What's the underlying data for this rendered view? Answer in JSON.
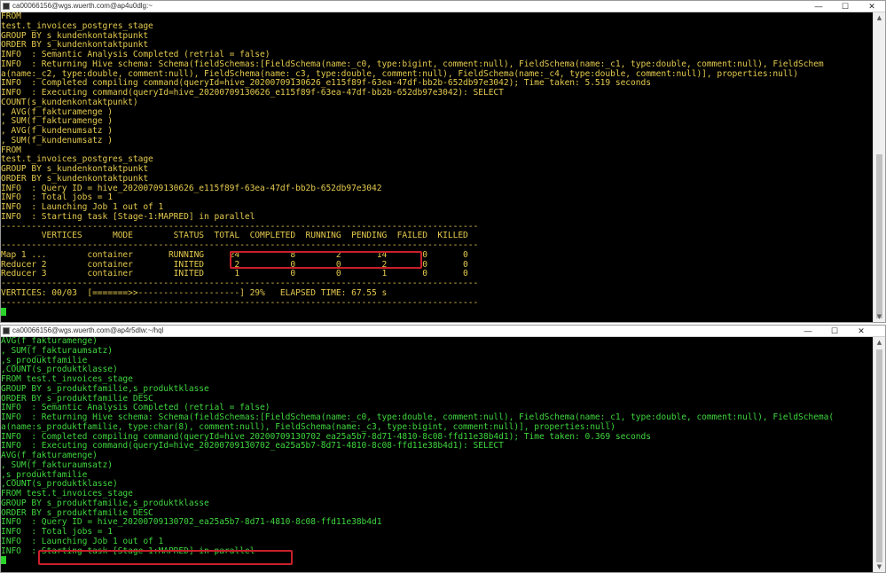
{
  "window_top": {
    "title": "ca00066156@wgs.wuerth.com@ap4u0dlg:~",
    "controls": [
      "—",
      "☐",
      "✕"
    ],
    "lines": [
      "FROM",
      "test.t_invoices_postgres_stage",
      "GROUP BY s_kundenkontaktpunkt",
      "ORDER BY s_kundenkontaktpunkt",
      "INFO  : Semantic Analysis Completed (retrial = false)",
      "INFO  : Returning Hive schema: Schema(fieldSchemas:[FieldSchema(name:_c0, type:bigint, comment:null), FieldSchema(name:_c1, type:double, comment:null), FieldSchem",
      "a(name:_c2, type:double, comment:null), FieldSchema(name:_c3, type:double, comment:null), FieldSchema(name:_c4, type:double, comment:null)], properties:null)",
      "INFO  : Completed compiling command(queryId=hive_20200709130626_e115f89f-63ea-47df-bb2b-652db97e3042); Time taken: 5.519 seconds",
      "INFO  : Executing command(queryId=hive_20200709130626_e115f89f-63ea-47df-bb2b-652db97e3042): SELECT",
      "COUNT(s_kundenkontaktpunkt)",
      ", AVG(f_fakturamenge )",
      ", SUM(f_fakturamenge )",
      ", AVG(f_kundenumsatz )",
      ", SUM(f_kundenumsatz )",
      "FROM",
      "test.t_invoices_postgres_stage",
      "GROUP BY s_kundenkontaktpunkt",
      "ORDER BY s_kundenkontaktpunkt",
      "INFO  : Query ID = hive_20200709130626_e115f89f-63ea-47df-bb2b-652db97e3042",
      "INFO  : Total jobs = 1",
      "INFO  : Launching Job 1 out of 1",
      "INFO  : Starting task [Stage-1:MAPRED] in parallel"
    ],
    "separator": "----------------------------------------------------------------------------------------------",
    "table_header": "        VERTICES      MODE        STATUS  TOTAL  COMPLETED  RUNNING  PENDING  FAILED  KILLED",
    "table_rows": [
      "Map 1 ...        container       RUNNING     24          8        2       14       0       0",
      "Reducer 2        container        INITED      2          0        0        2       0       0",
      "Reducer 3        container        INITED      1          0        0        1       0       0"
    ],
    "progress_line": "VERTICES: 00/03  [=======>>--------------------] 29%   ELAPSED TIME: 67.55 s",
    "highlight_color": "#c8202a"
  },
  "window_bottom": {
    "title": "ca00066156@wgs.wuerth.com@ap4r5dlw:~/hql",
    "controls": [
      "—",
      "☐",
      "✕"
    ],
    "lines": [
      "AVG(f_fakturamenge)",
      ", SUM(f_fakturaumsatz)",
      ",s_produktfamilie",
      ",COUNT(s_produktklasse)",
      "FROM test.t_invoices_stage",
      "GROUP BY s_produktfamilie,s_produktklasse",
      "ORDER BY s_produktfamilie DESC",
      "INFO  : Semantic Analysis Completed (retrial = false)",
      "INFO  : Returning Hive schema: Schema(fieldSchemas:[FieldSchema(name:_c0, type:double, comment:null), FieldSchema(name:_c1, type:double, comment:null), FieldSchema(",
      "a(name:s_produktfamilie, type:char(8), comment:null), FieldSchema(name:_c3, type:bigint, comment:null)], properties:null)",
      "INFO  : Completed compiling command(queryId=hive_20200709130702_ea25a5b7-8d71-4810-8c08-ffd11e38b4d1); Time taken: 0.369 seconds",
      "INFO  : Executing command(queryId=hive_20200709130702_ea25a5b7-8d71-4810-8c08-ffd11e38b4d1): SELECT",
      "AVG(f_fakturamenge)",
      ", SUM(f_fakturaumsatz)",
      ",s_produktfamilie",
      ",COUNT(s_produktklasse)",
      "FROM test.t_invoices_stage",
      "GROUP BY s_produktfamilie,s_produktklasse",
      "ORDER BY s_produktfamilie DESC",
      "INFO  : Query ID = hive_20200709130702_ea25a5b7-8d71-4810-8c08-ffd11e38b4d1",
      "INFO  : Total jobs = 1",
      "INFO  : Launching Job 1 out of 1",
      "INFO  : Starting task [Stage-1:MAPRED] in parallel"
    ]
  }
}
